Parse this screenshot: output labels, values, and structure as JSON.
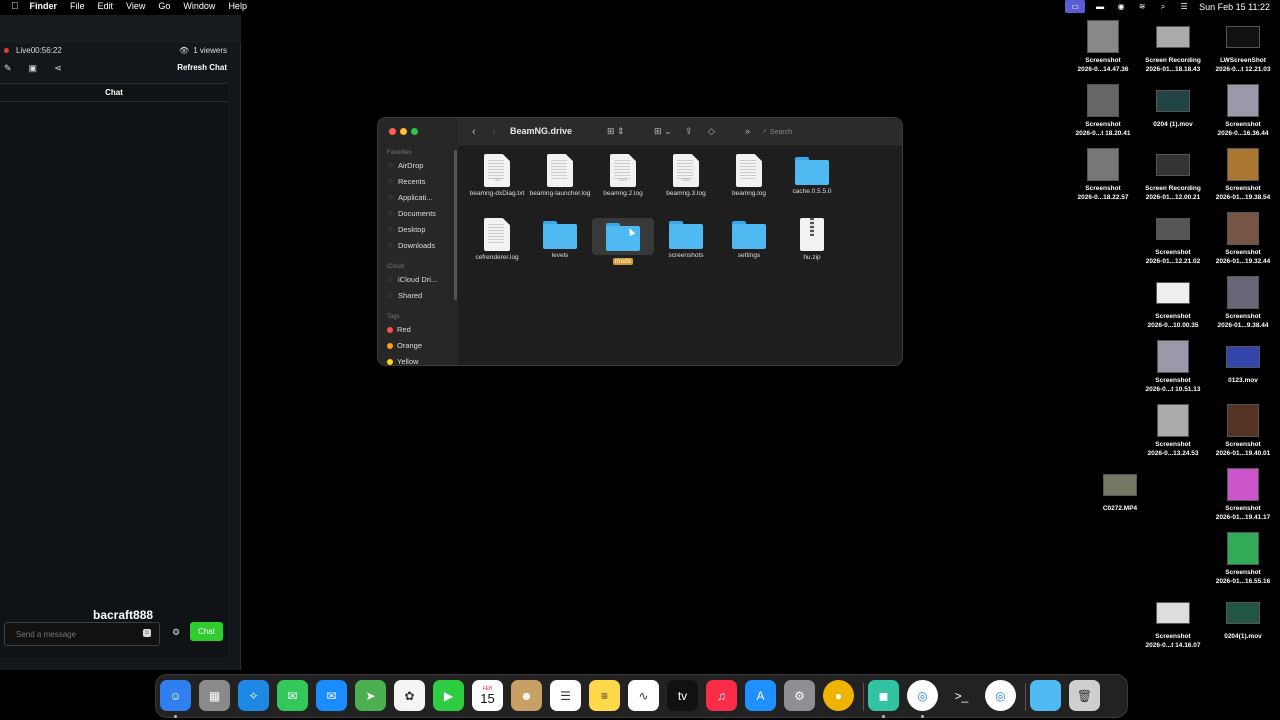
{
  "menubar": {
    "app_name": "Finder",
    "menus": [
      "File",
      "Edit",
      "View",
      "Go",
      "Window",
      "Help"
    ],
    "clock": "Sun Feb 15  11:22"
  },
  "stream_panel": {
    "live_label": "Live",
    "live_time": "00:56:22",
    "viewers": "1 viewers",
    "refresh_chat": "Refresh Chat",
    "chat_title": "Chat",
    "streamer_name": "bacraft888",
    "message_placeholder": "Send a message",
    "chat_button": "Chat",
    "accent_green": "#2ecc2e"
  },
  "finder": {
    "title": "BeamNG.drive",
    "search_placeholder": "Search",
    "sidebar": {
      "favorites_header": "Favorites",
      "favorites": [
        {
          "label": "AirDrop",
          "icon": "airdrop-icon"
        },
        {
          "label": "Recents",
          "icon": "clock-icon"
        },
        {
          "label": "Applicati...",
          "icon": "applications-icon"
        },
        {
          "label": "Documents",
          "icon": "document-icon"
        },
        {
          "label": "Desktop",
          "icon": "desktop-icon"
        },
        {
          "label": "Downloads",
          "icon": "download-icon"
        }
      ],
      "icloud_header": "iCloud",
      "icloud": [
        {
          "label": "iCloud Dri...",
          "icon": "cloud-icon"
        },
        {
          "label": "Shared",
          "icon": "shared-folder-icon"
        }
      ],
      "tags_header": "Tags",
      "tags": [
        {
          "label": "Red",
          "color": "#ff4d4d"
        },
        {
          "label": "Orange",
          "color": "#ff9f0a"
        },
        {
          "label": "Yellow",
          "color": "#ffd60a"
        }
      ]
    },
    "files": [
      {
        "name": "beamng-dxDiag.txt",
        "kind": "doc",
        "ext": "TXT"
      },
      {
        "name": "beamng-launcher.log",
        "kind": "doc",
        "ext": ""
      },
      {
        "name": "beamng.2.log",
        "kind": "doc",
        "ext": "LOG"
      },
      {
        "name": "beamng.3.log",
        "kind": "doc",
        "ext": "LOG"
      },
      {
        "name": "beamng.log",
        "kind": "doc",
        "ext": ""
      },
      {
        "name": "cache.0.5.5.0",
        "kind": "folder",
        "ext": ""
      },
      {
        "name": "cefrenderer.log",
        "kind": "doc",
        "ext": ""
      },
      {
        "name": "levels",
        "kind": "folder",
        "ext": ""
      },
      {
        "name": "mods",
        "kind": "folder",
        "ext": "",
        "selected": true
      },
      {
        "name": "screenshots",
        "kind": "folder",
        "ext": ""
      },
      {
        "name": "settings",
        "kind": "folder",
        "ext": ""
      },
      {
        "name": "hu.zip",
        "kind": "zip",
        "ext": "ZIP"
      }
    ]
  },
  "desktop": [
    {
      "line1": "Screenshot",
      "line2": "2026-0...14.47.36"
    },
    {
      "line1": "Screen Recording",
      "line2": "2026-01...18.18.43"
    },
    {
      "line1": "LWScreenShot",
      "line2": "2026-0...t 12.21.03"
    },
    {
      "line1": "Screenshot",
      "line2": "2026-0...t 18.20.41"
    },
    {
      "line1": "0204 (1).mov",
      "line2": ""
    },
    {
      "line1": "Screenshot",
      "line2": "2026-0...16.36.44"
    },
    {
      "line1": "Screenshot",
      "line2": "2026-0...18.22.57"
    },
    {
      "line1": "Screen Recording",
      "line2": "2026-01...12.00.21"
    },
    {
      "line1": "Screenshot",
      "line2": "2026-01...19.38.54"
    },
    {
      "line1": "Screenshot",
      "line2": "2026-01...12.21.02"
    },
    {
      "line1": "Screenshot",
      "line2": "2026-01...19.32.44"
    },
    {
      "line1": "Screenshot",
      "line2": "2026-0...10.00.35"
    },
    {
      "line1": "Screenshot",
      "line2": "2026-01...9.38.44"
    },
    {
      "line1": "Screenshot",
      "line2": "2026-0...t 10.51.13"
    },
    {
      "line1": "0123.mov",
      "line2": ""
    },
    {
      "line1": "Screenshot",
      "line2": "2026-0...13.24.53"
    },
    {
      "line1": "Screenshot",
      "line2": "2026-01...19.40.01"
    },
    {
      "line1": "C0272.MP4",
      "line2": ""
    },
    {
      "line1": "Screenshot",
      "line2": "2026-01...19.41.17"
    },
    {
      "line1": "Screenshot",
      "line2": "2026-01...16.55.16"
    },
    {
      "line1": "Screenshot",
      "line2": "2026-0...t 14.16.07"
    },
    {
      "line1": "0204(1).mov",
      "line2": ""
    }
  ],
  "dock": {
    "calendar_month": "FEB",
    "calendar_day": "15",
    "apps": [
      {
        "name": "finder-icon",
        "color": "#2f7ff0"
      },
      {
        "name": "launchpad-icon",
        "color": "#8a8a8a"
      },
      {
        "name": "safari-icon",
        "color": "#1e88e5"
      },
      {
        "name": "messages-icon",
        "color": "#34c759"
      },
      {
        "name": "mail-icon",
        "color": "#1a8cff"
      },
      {
        "name": "maps-icon",
        "color": "#4caf50"
      },
      {
        "name": "photos-icon",
        "color": "#f5f5f5"
      },
      {
        "name": "facetime-icon",
        "color": "#2ecc40"
      },
      {
        "name": "calendar-icon",
        "color": "#ffffff"
      },
      {
        "name": "contacts-icon",
        "color": "#c8a063"
      },
      {
        "name": "reminders-icon",
        "color": "#ffffff"
      },
      {
        "name": "notes-icon",
        "color": "#ffd84a"
      },
      {
        "name": "freeform-icon",
        "color": "#ffffff"
      },
      {
        "name": "appletv-icon",
        "color": "#111111"
      },
      {
        "name": "music-icon",
        "color": "#fa2d48"
      },
      {
        "name": "appstore-icon",
        "color": "#1e90ff"
      },
      {
        "name": "settings-icon",
        "color": "#8e8e93"
      },
      {
        "name": "stream-app-icon",
        "color": "#6b4bd6"
      },
      {
        "name": "streamlabs-icon",
        "color": "#31c3a2"
      },
      {
        "name": "chrome-icon",
        "color": "#ffffff"
      },
      {
        "name": "terminal-icon",
        "color": "#222222"
      },
      {
        "name": "chrome-profile-icon",
        "color": "#ffffff"
      },
      {
        "name": "downloads-folder-icon",
        "color": "#4fb9f2"
      },
      {
        "name": "trash-icon",
        "color": "#cfcfcf"
      }
    ]
  }
}
